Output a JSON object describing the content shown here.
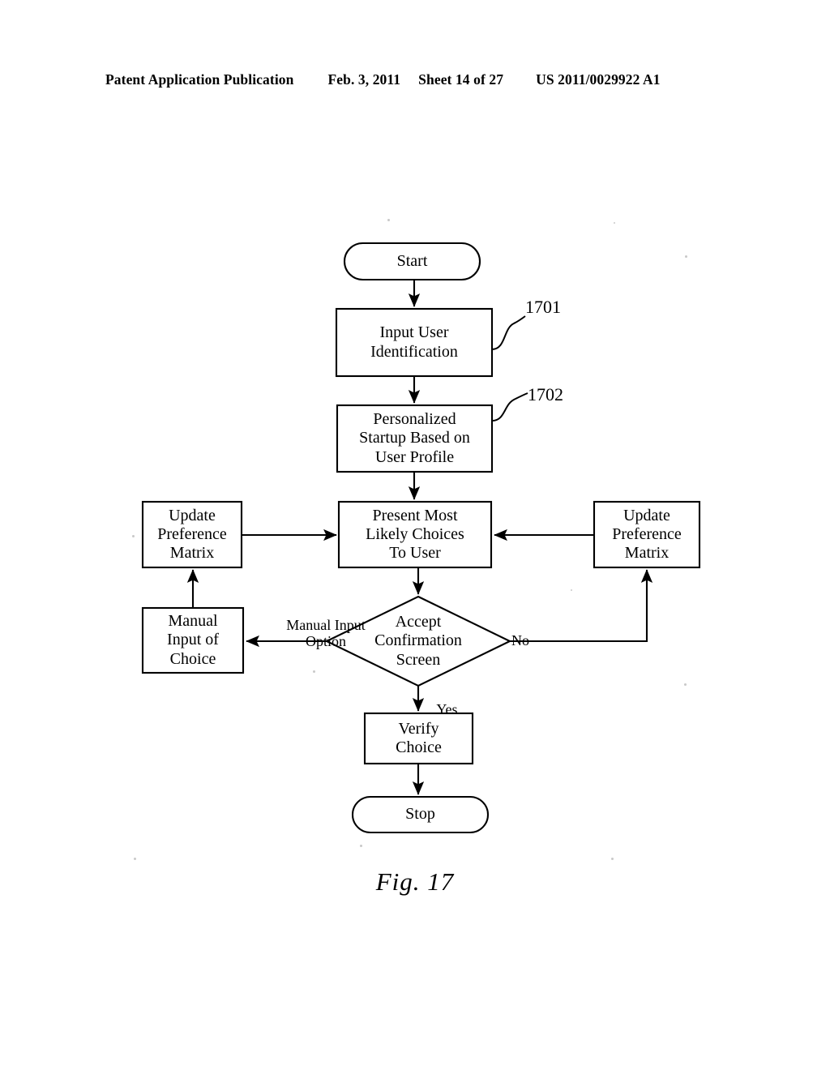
{
  "header": {
    "publication": "Patent Application Publication",
    "date": "Feb. 3, 2011",
    "sheet": "Sheet 14 of 27",
    "number": "US 2011/0029922 A1"
  },
  "figure": {
    "caption": "Fig. 17"
  },
  "flowchart": {
    "nodes": {
      "start": {
        "label": "Start",
        "shape": "terminator"
      },
      "input_user_identification": {
        "line1": "Input User",
        "line2": "Identification",
        "shape": "process"
      },
      "personalized_startup": {
        "line1": "Personalized",
        "line2": "Startup Based on",
        "line3": "User Profile",
        "shape": "process"
      },
      "update_preference_matrix_left": {
        "line1": "Update",
        "line2": "Preference",
        "line3": "Matrix",
        "shape": "process"
      },
      "present_most_likely_choices": {
        "line1": "Present Most",
        "line2": "Likely Choices",
        "line3": "To User",
        "shape": "process"
      },
      "update_preference_matrix_right": {
        "line1": "Update",
        "line2": "Preference",
        "line3": "Matrix",
        "shape": "process"
      },
      "manual_input_of_choice": {
        "line1": "Manual",
        "line2": "Input of",
        "line3": "Choice",
        "shape": "process"
      },
      "accept_confirmation_screen": {
        "line1": "Accept",
        "line2": "Confirmation",
        "line3": "Screen",
        "shape": "decision"
      },
      "verify_choice": {
        "line1": "Verify",
        "line2": "Choice",
        "shape": "process"
      },
      "stop": {
        "label": "Stop",
        "shape": "terminator"
      }
    },
    "edge_labels": {
      "manual_input_option_line1": "Manual Input",
      "manual_input_option_line2": "Option",
      "no": "No",
      "yes": "Yes"
    },
    "reference_numerals": {
      "ref_1701": "1701",
      "ref_1702": "1702"
    }
  },
  "colors": {
    "ink": "#000000",
    "paper": "#ffffff"
  }
}
